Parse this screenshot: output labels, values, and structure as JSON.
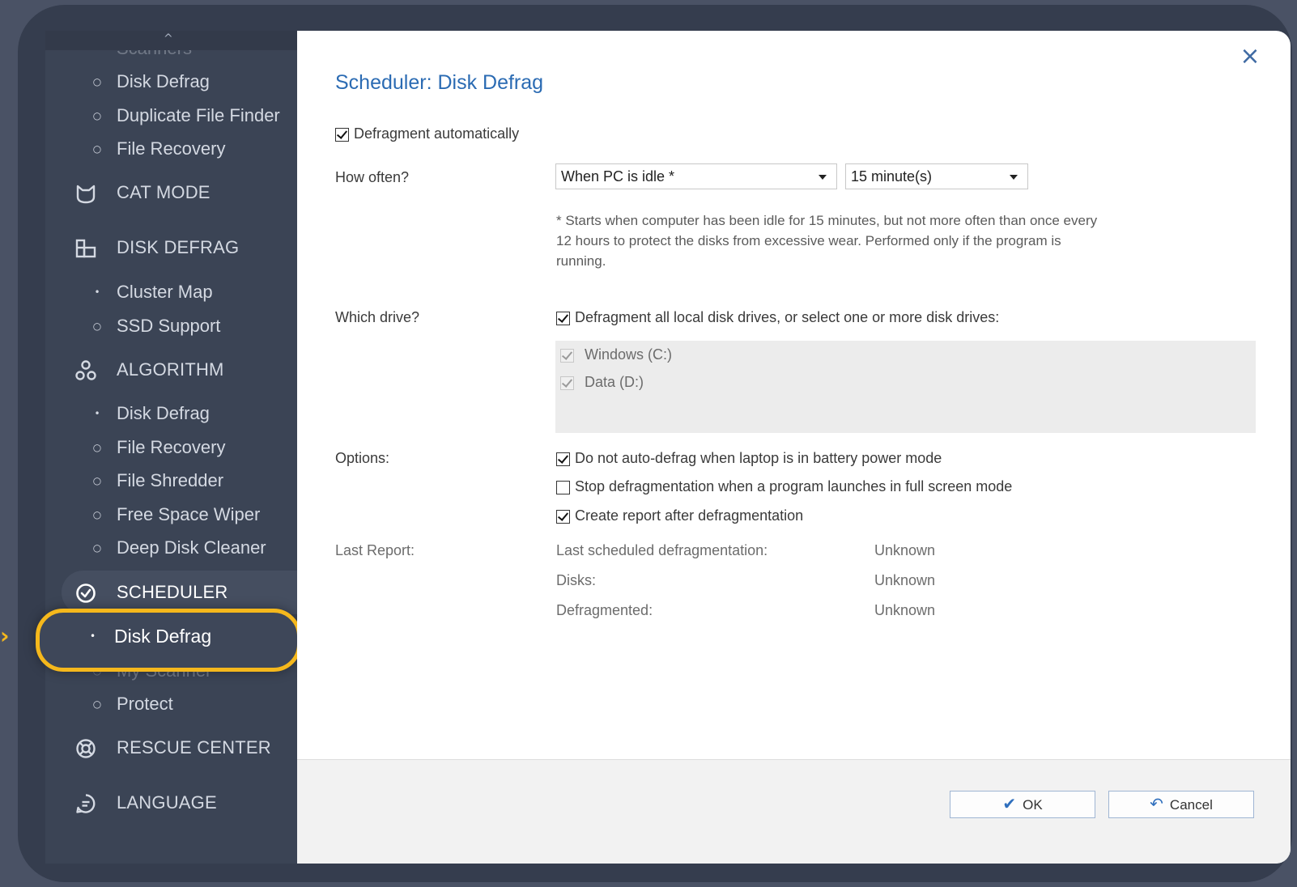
{
  "sidebar": {
    "scroll_up": "^",
    "items": [
      {
        "type": "item",
        "label": "Scanners",
        "bullet": "•"
      },
      {
        "type": "item",
        "label": "Disk Defrag",
        "bullet": "○"
      },
      {
        "type": "item",
        "label": "Duplicate File Finder",
        "bullet": "○"
      },
      {
        "type": "item",
        "label": "File Recovery",
        "bullet": "○"
      },
      {
        "type": "section",
        "label": "CAT MODE",
        "icon": "cat-icon"
      },
      {
        "type": "section",
        "label": "DISK DEFRAG",
        "icon": "disk-defrag-icon"
      },
      {
        "type": "item",
        "label": "Cluster Map",
        "bullet": "•"
      },
      {
        "type": "item",
        "label": "SSD Support",
        "bullet": "○"
      },
      {
        "type": "section",
        "label": "ALGORITHM",
        "icon": "algorithm-icon"
      },
      {
        "type": "item",
        "label": "Disk Defrag",
        "bullet": "•"
      },
      {
        "type": "item",
        "label": "File Recovery",
        "bullet": "○"
      },
      {
        "type": "item",
        "label": "File Shredder",
        "bullet": "○"
      },
      {
        "type": "item",
        "label": "Free Space Wiper",
        "bullet": "○"
      },
      {
        "type": "item",
        "label": "Deep Disk Cleaner",
        "bullet": "○"
      },
      {
        "type": "section",
        "label": "SCHEDULER",
        "icon": "clock-icon",
        "active": true
      },
      {
        "type": "item",
        "label": "Disk Defrag",
        "bullet": "•",
        "highlighted": true
      },
      {
        "type": "item",
        "label": "My Scanner",
        "bullet": "○"
      },
      {
        "type": "item",
        "label": "Protect",
        "bullet": "○"
      },
      {
        "type": "section",
        "label": "RESCUE CENTER",
        "icon": "lifebuoy-icon"
      },
      {
        "type": "section",
        "label": "LANGUAGE",
        "icon": "language-icon"
      }
    ]
  },
  "dialog": {
    "title": "Scheduler: Disk Defrag",
    "close_icon": "×",
    "defrag_auto": {
      "label": "Defragment automatically",
      "checked": true
    },
    "how_often": {
      "label": "How often?",
      "frequency": "When PC is idle *",
      "interval": "15 minute(s)"
    },
    "note": "* Starts when computer has been idle for 15 minutes, but not more often than once every 12 hours to protect the disks from excessive wear. Performed only if the program is running.",
    "which_drive": {
      "label": "Which drive?",
      "all_drives_label": "Defragment all local disk drives, or select one or more disk drives:",
      "all_drives_checked": true,
      "drives": [
        {
          "label": "Windows (C:)",
          "checked": true
        },
        {
          "label": "Data (D:)",
          "checked": true
        }
      ]
    },
    "options": {
      "label": "Options:",
      "items": [
        {
          "label": "Do not auto-defrag when laptop is in battery power mode",
          "checked": true
        },
        {
          "label": "Stop defragmentation when a program launches in full screen mode",
          "checked": false
        },
        {
          "label": "Create report after defragmentation",
          "checked": true
        }
      ]
    },
    "last_report": {
      "label": "Last Report:",
      "rows": [
        {
          "key": "Last scheduled defragmentation:",
          "value": "Unknown"
        },
        {
          "key": "Disks:",
          "value": "Unknown"
        },
        {
          "key": "Defragmented:",
          "value": "Unknown"
        }
      ]
    },
    "buttons": {
      "ok_label": "OK",
      "ok_icon": "✔",
      "cancel_label": "Cancel",
      "cancel_icon": "↶"
    }
  },
  "colors": {
    "accent": "#2b6bb3",
    "highlight": "#f5b81c",
    "sidebar_bg": "#3b4455"
  }
}
